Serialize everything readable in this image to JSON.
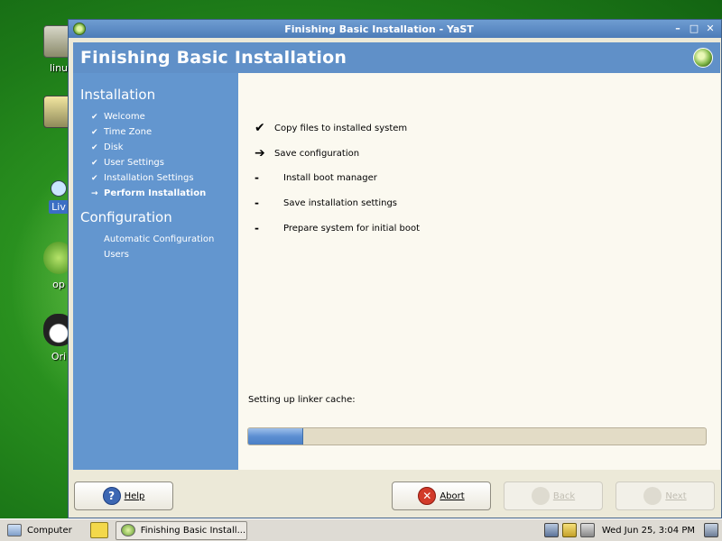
{
  "desktop": {
    "icons": [
      {
        "label": "linu",
        "selected": false
      },
      {
        "label": "",
        "selected": false
      },
      {
        "label": "Liv",
        "selected": true
      },
      {
        "label": "op",
        "selected": false
      },
      {
        "label": "Ori",
        "selected": false
      }
    ]
  },
  "window": {
    "title": "Finishing Basic Installation - YaST",
    "banner_title": "Finishing Basic Installation",
    "sidebar": {
      "installation_title": "Installation",
      "installation_steps": [
        {
          "label": "Welcome",
          "mark": "✔",
          "current": false
        },
        {
          "label": "Time Zone",
          "mark": "✔",
          "current": false
        },
        {
          "label": "Disk",
          "mark": "✔",
          "current": false
        },
        {
          "label": "User Settings",
          "mark": "✔",
          "current": false
        },
        {
          "label": "Installation Settings",
          "mark": "✔",
          "current": false
        },
        {
          "label": "Perform Installation",
          "mark": "→",
          "current": true
        }
      ],
      "configuration_title": "Configuration",
      "configuration_steps": [
        {
          "label": "Automatic Configuration"
        },
        {
          "label": "Users"
        }
      ]
    },
    "tasks": [
      {
        "label": "Copy files to installed system",
        "status": "done",
        "icon": "✔"
      },
      {
        "label": "Save configuration",
        "status": "current",
        "icon": "➔"
      },
      {
        "label": "Install boot manager",
        "status": "pending",
        "icon": "-"
      },
      {
        "label": "Save installation settings",
        "status": "pending",
        "icon": "-"
      },
      {
        "label": "Prepare system for initial boot",
        "status": "pending",
        "icon": "-"
      }
    ],
    "progress": {
      "label": "Setting up linker cache:",
      "fraction": 0.12
    },
    "buttons": {
      "help": {
        "label": "Help",
        "icon": "help-icon"
      },
      "abort": {
        "label": "Abort",
        "icon": "abort-icon"
      },
      "back": {
        "label": "Back",
        "enabled": false
      },
      "next": {
        "label": "Next",
        "enabled": false
      }
    }
  },
  "taskbar": {
    "computer_label": "Computer",
    "task_label": "Finishing Basic Install...",
    "clock": "Wed Jun 25,  3:04 PM"
  },
  "colors": {
    "banner": "#6090c8",
    "sidebar": "#6396cf",
    "progress_fill": "#5c8fd2"
  }
}
